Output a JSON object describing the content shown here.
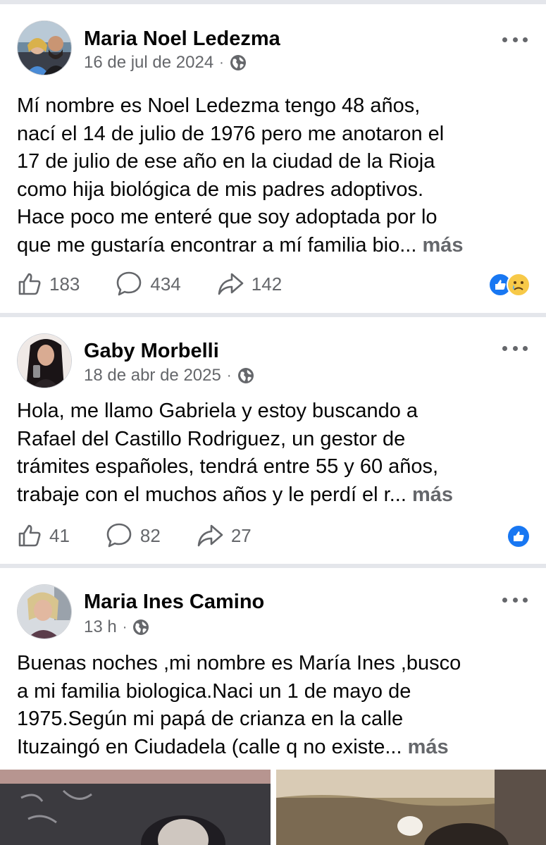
{
  "posts": [
    {
      "author": "Maria Noel Ledezma",
      "date": "16 de jul de 2024",
      "separator": "·",
      "icon": "globe-icon",
      "text_lines": [
        "Mí nombre es Noel Ledezma tengo 48 años,",
        "nací el 14 de julio de 1976 pero me anotaron el",
        "17 de julio de ese año en la ciudad de la Rioja",
        "como hija biológica de mis padres adoptivos.",
        "Hace poco me enteré que soy adoptada por lo",
        "que me gustaría encontrar a mí familia bio..."
      ],
      "more_label": "más",
      "likes": "183",
      "comments": "434",
      "shares": "142",
      "reactions": [
        "like",
        "sad"
      ]
    },
    {
      "author": "Gaby Morbelli",
      "date": "18 de abr de 2025",
      "separator": "·",
      "icon": "globe-icon",
      "text_lines": [
        "Hola, me llamo Gabriela y estoy buscando a",
        "Rafael del Castillo Rodriguez, un gestor de",
        "trámites españoles, tendrá entre 55 y 60 años,",
        "trabaje con el muchos años y le perdí el r..."
      ],
      "more_label": "más",
      "likes": "41",
      "comments": "82",
      "shares": "27",
      "reactions": [
        "like"
      ]
    },
    {
      "author": "Maria Ines Camino",
      "date": "13 h",
      "separator": "·",
      "icon": "globe-icon",
      "text_lines": [
        "Buenas noches ,mi nombre es María Ines ,busco",
        "a mi familia biologica.Naci un 1 de mayo de",
        "1975.Según mi papá de crianza en la calle",
        "Ituzaingó en Ciudadela (calle q no existe..."
      ],
      "more_label": "más"
    }
  ],
  "colors": {
    "accent": "#1877f2",
    "secondary_text": "#65676b",
    "divider": "#e4e6eb"
  }
}
